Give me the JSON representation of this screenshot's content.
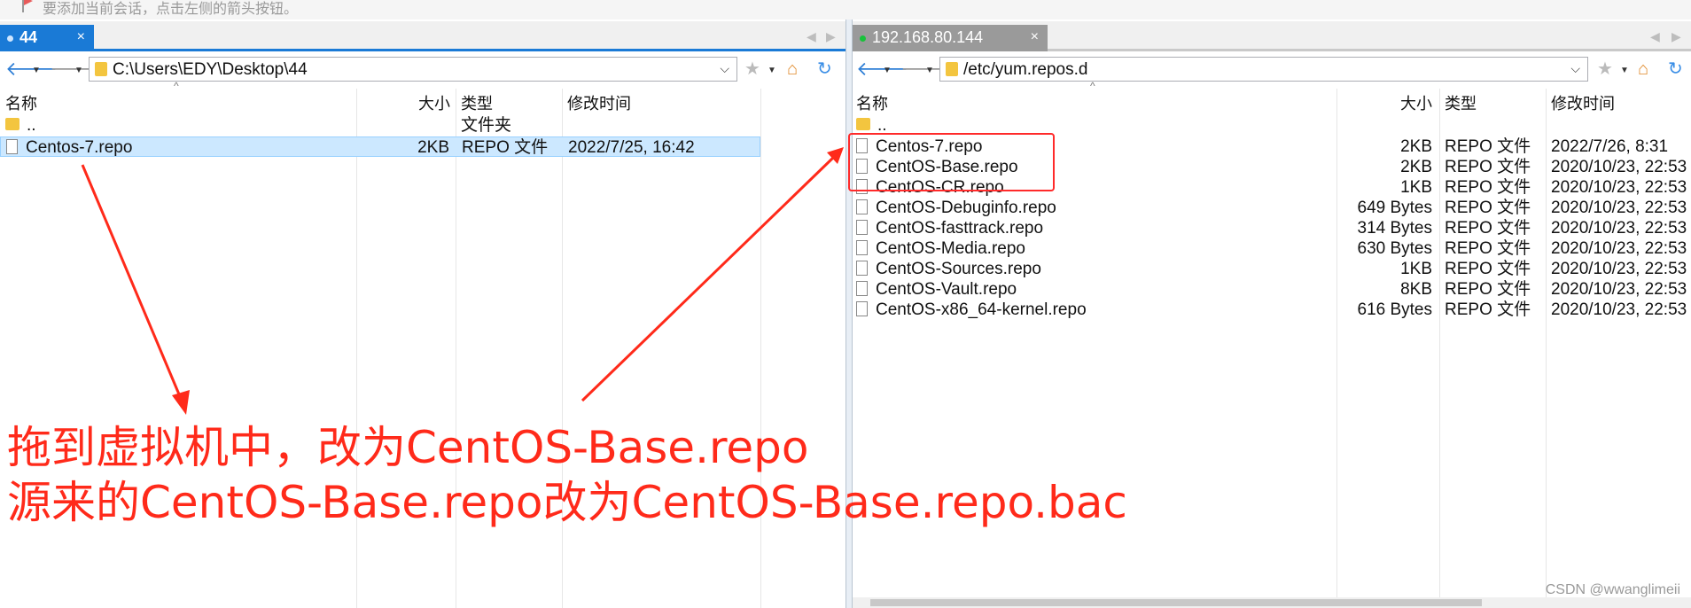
{
  "hint": {
    "text": "要添加当前会话，点击左侧的箭头按钮。"
  },
  "left": {
    "tab": {
      "label": "44",
      "close": "×"
    },
    "path": "C:\\Users\\EDY\\Desktop\\44",
    "columns": {
      "name": "名称",
      "size": "大小",
      "type": "类型",
      "modified": "修改时间"
    },
    "parent": {
      "name": "..",
      "type": "文件夹"
    },
    "files": [
      {
        "name": "Centos-7.repo",
        "size": "2KB",
        "type": "REPO 文件",
        "modified": "2022/7/25, 16:42"
      }
    ]
  },
  "right": {
    "tab": {
      "label": "192.168.80.144",
      "close": "×"
    },
    "path": "/etc/yum.repos.d",
    "columns": {
      "name": "名称",
      "size": "大小",
      "type": "类型",
      "modified": "修改时间"
    },
    "parent": {
      "name": ".."
    },
    "files": [
      {
        "name": "Centos-7.repo",
        "size": "2KB",
        "type": "REPO 文件",
        "modified": "2022/7/26, 8:31"
      },
      {
        "name": "CentOS-Base.repo",
        "size": "2KB",
        "type": "REPO 文件",
        "modified": "2020/10/23, 22:53"
      },
      {
        "name": "CentOS-CR.repo",
        "size": "1KB",
        "type": "REPO 文件",
        "modified": "2020/10/23, 22:53"
      },
      {
        "name": "CentOS-Debuginfo.repo",
        "size": "649 Bytes",
        "type": "REPO 文件",
        "modified": "2020/10/23, 22:53"
      },
      {
        "name": "CentOS-fasttrack.repo",
        "size": "314 Bytes",
        "type": "REPO 文件",
        "modified": "2020/10/23, 22:53"
      },
      {
        "name": "CentOS-Media.repo",
        "size": "630 Bytes",
        "type": "REPO 文件",
        "modified": "2020/10/23, 22:53"
      },
      {
        "name": "CentOS-Sources.repo",
        "size": "1KB",
        "type": "REPO 文件",
        "modified": "2020/10/23, 22:53"
      },
      {
        "name": "CentOS-Vault.repo",
        "size": "8KB",
        "type": "REPO 文件",
        "modified": "2020/10/23, 22:53"
      },
      {
        "name": "CentOS-x86_64-kernel.repo",
        "size": "616 Bytes",
        "type": "REPO 文件",
        "modified": "2020/10/23, 22:53"
      }
    ]
  },
  "annotation": {
    "line1": "拖到虚拟机中，改为CentOS-Base.repo",
    "line2": "源来的CentOS-Base.repo改为CentOS-Base.repo.bac",
    "color": "#ff2a1a"
  },
  "watermark": "CSDN @wwanglimeii"
}
